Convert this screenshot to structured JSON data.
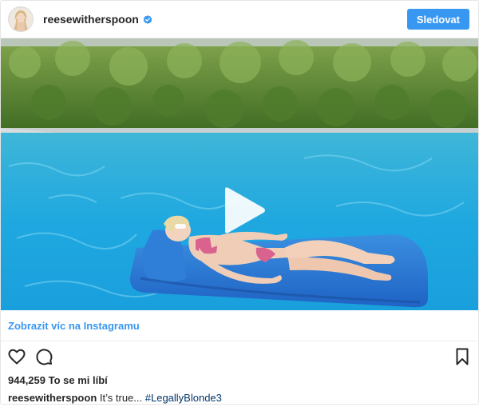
{
  "header": {
    "username": "reesewitherspoon",
    "follow_label": "Sledovat"
  },
  "media": {
    "type": "video",
    "play_icon": "play-icon"
  },
  "view_more_label": "Zobrazit víc na Instagramu",
  "actions": {
    "like_icon": "heart-icon",
    "comment_icon": "comment-icon",
    "save_icon": "bookmark-icon"
  },
  "likes": {
    "count": "944,259",
    "label": "To se mi líbí"
  },
  "caption": {
    "username": "reesewitherspoon",
    "text": "It’s true...",
    "hashtag": "#LegallyBlonde3"
  },
  "colors": {
    "accent": "#3897f0",
    "hashtag": "#003569",
    "verified": "#3897f0"
  }
}
